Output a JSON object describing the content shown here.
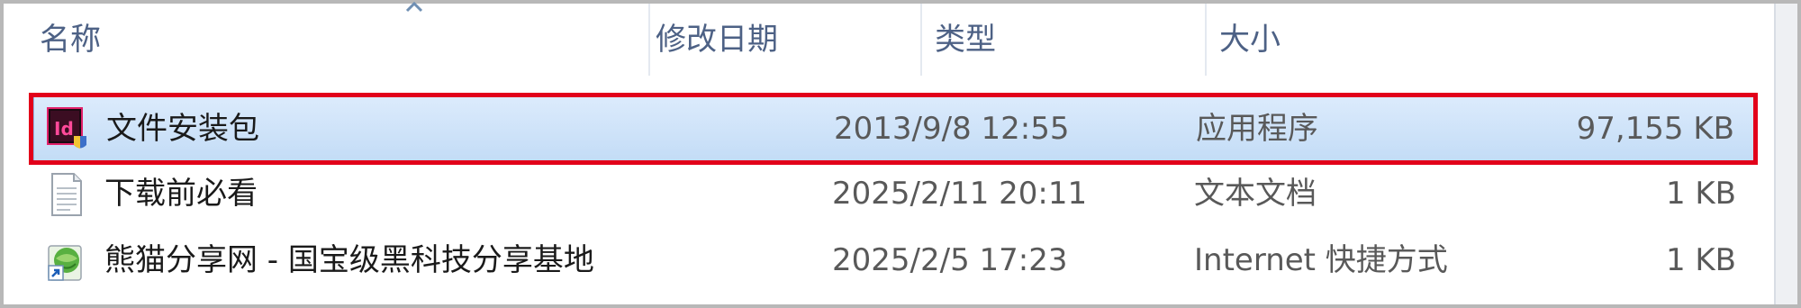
{
  "columns": {
    "name": "名称",
    "date": "修改日期",
    "type": "类型",
    "size": "大小"
  },
  "files": [
    {
      "name": "文件安装包",
      "date": "2013/9/8 12:55",
      "type": "应用程序",
      "size": "97,155 KB",
      "icon": "indesign-installer-icon",
      "selected": true
    },
    {
      "name": "下载前必看",
      "date": "2025/2/11 20:11",
      "type": "文本文档",
      "size": "1 KB",
      "icon": "text-document-icon",
      "selected": false
    },
    {
      "name": "熊猫分享网 - 国宝级黑科技分享基地",
      "date": "2025/2/5 17:23",
      "type": "Internet 快捷方式",
      "size": "1 KB",
      "icon": "internet-shortcut-icon",
      "selected": false
    }
  ],
  "colors": {
    "highlight": "#e2001a",
    "selection": "#c3dcf6",
    "header_text": "#4d6185"
  },
  "icon_texts": {
    "installer": "Id"
  }
}
